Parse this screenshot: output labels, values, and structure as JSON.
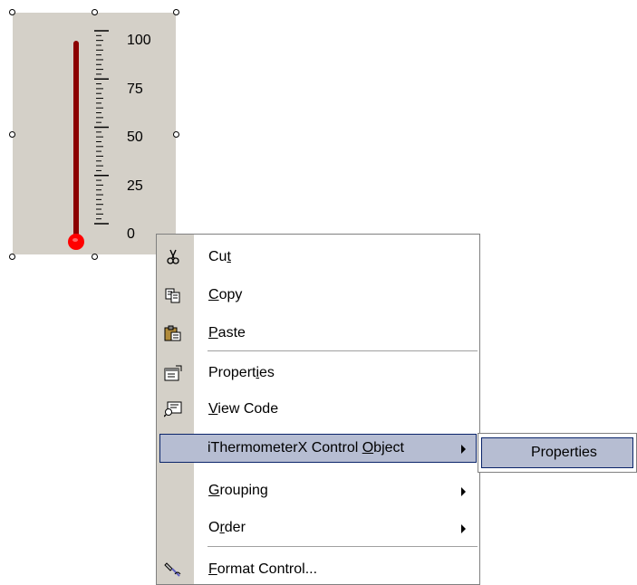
{
  "thermometer": {
    "scale_labels": [
      "100",
      "75",
      "50",
      "25",
      "0"
    ],
    "scale_min": 0,
    "scale_max": 100,
    "value_fraction": 1.0,
    "tube_color": "#8b0000",
    "bulb_color": "#ff0000",
    "background_color": "#d4d0c8"
  },
  "context_menu": {
    "items": [
      {
        "pre": "Cu",
        "key": "t",
        "post": "",
        "icon": "scissors-icon"
      },
      {
        "pre": "",
        "key": "C",
        "post": "opy",
        "icon": "copy-icon"
      },
      {
        "pre": "",
        "key": "P",
        "post": "aste",
        "icon": "paste-icon"
      },
      {
        "pre": "Propert",
        "key": "i",
        "post": "es",
        "icon": "properties-icon"
      },
      {
        "pre": "",
        "key": "V",
        "post": "iew Code",
        "icon": "view-code-icon"
      },
      {
        "pre": "iThermometerX Control ",
        "key": "O",
        "post": "bject",
        "icon": "",
        "submenu": true,
        "highlighted": true
      },
      {
        "pre": "",
        "key": "G",
        "post": "rouping",
        "icon": "",
        "submenu": true
      },
      {
        "pre": "O",
        "key": "r",
        "post": "der",
        "icon": "",
        "submenu": true
      },
      {
        "pre": "",
        "key": "F",
        "post": "ormat Control...",
        "icon": "format-control-icon"
      }
    ]
  },
  "submenu": {
    "items": [
      "Properties"
    ]
  },
  "colors": {
    "highlight": "#b6bdd2",
    "highlight_border": "#0a246a",
    "menu_gutter": "#d4d0c8"
  }
}
